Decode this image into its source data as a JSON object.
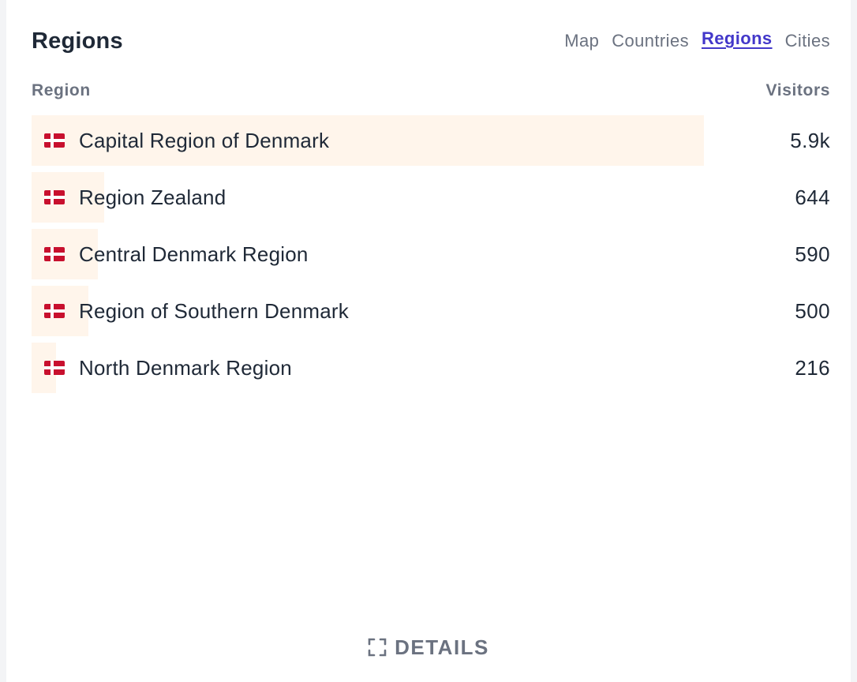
{
  "header": {
    "title": "Regions",
    "tabs": [
      {
        "label": "Map",
        "active": false
      },
      {
        "label": "Countries",
        "active": false
      },
      {
        "label": "Regions",
        "active": true
      },
      {
        "label": "Cities",
        "active": false
      }
    ]
  },
  "columns": {
    "left": "Region",
    "right": "Visitors"
  },
  "rows": [
    {
      "flag": "denmark-flag-icon",
      "name": "Capital Region of Denmark",
      "visitors": "5.9k",
      "bar_fraction": 0.842
    },
    {
      "flag": "denmark-flag-icon",
      "name": "Region Zealand",
      "visitors": "644",
      "bar_fraction": 0.091
    },
    {
      "flag": "denmark-flag-icon",
      "name": "Central Denmark Region",
      "visitors": "590",
      "bar_fraction": 0.083
    },
    {
      "flag": "denmark-flag-icon",
      "name": "Region of Southern Denmark",
      "visitors": "500",
      "bar_fraction": 0.071
    },
    {
      "flag": "denmark-flag-icon",
      "name": "North Denmark Region",
      "visitors": "216",
      "bar_fraction": 0.031
    }
  ],
  "footer": {
    "details_label": "DETAILS",
    "details_icon": "expand-icon"
  },
  "colors": {
    "accent": "#4338ca",
    "bar": "#fff5eb",
    "text": "#1f2937",
    "muted": "#6b7280"
  }
}
